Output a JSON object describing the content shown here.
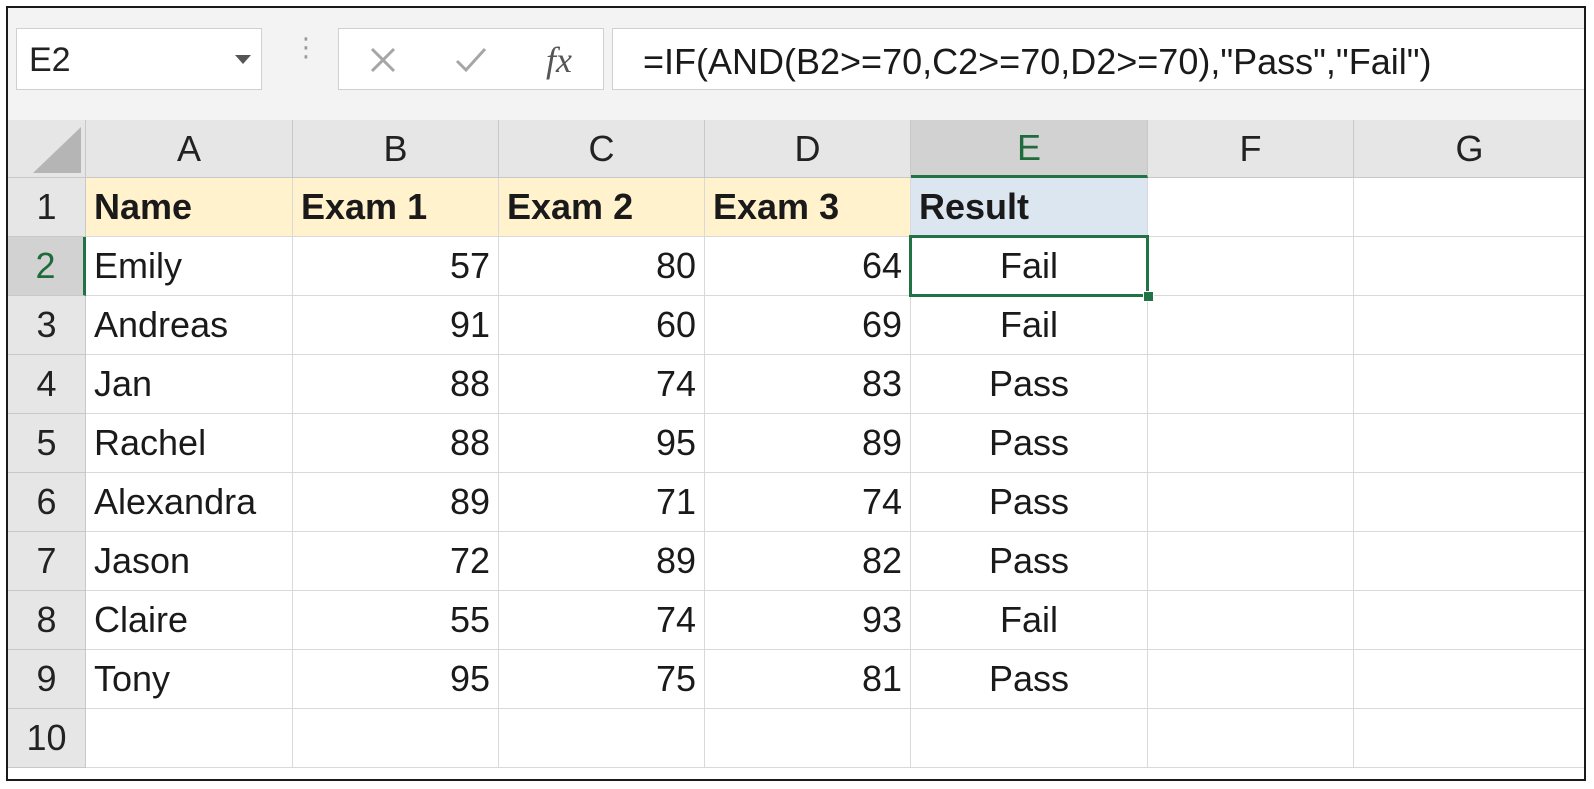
{
  "formula_bar": {
    "name_box": "E2",
    "formula": "=IF(AND(B2>=70,C2>=70,D2>=70),\"Pass\",\"Fail\")",
    "cancel_icon": "close-icon",
    "enter_icon": "check-icon",
    "function_label": "fx"
  },
  "columns": [
    "A",
    "B",
    "C",
    "D",
    "E",
    "F",
    "G"
  ],
  "selected_cell": {
    "column": "E",
    "row": "2"
  },
  "header_row": {
    "row": "1",
    "cells": [
      "Name",
      "Exam 1",
      "Exam 2",
      "Exam 3",
      "Result"
    ]
  },
  "data_rows": [
    {
      "row": "2",
      "name": "Emily",
      "exam1": "57",
      "exam2": "80",
      "exam3": "64",
      "result": "Fail"
    },
    {
      "row": "3",
      "name": "Andreas",
      "exam1": "91",
      "exam2": "60",
      "exam3": "69",
      "result": "Fail"
    },
    {
      "row": "4",
      "name": "Jan",
      "exam1": "88",
      "exam2": "74",
      "exam3": "83",
      "result": "Pass"
    },
    {
      "row": "5",
      "name": "Rachel",
      "exam1": "88",
      "exam2": "95",
      "exam3": "89",
      "result": "Pass"
    },
    {
      "row": "6",
      "name": "Alexandra",
      "exam1": "89",
      "exam2": "71",
      "exam3": "74",
      "result": "Pass"
    },
    {
      "row": "7",
      "name": "Jason",
      "exam1": "72",
      "exam2": "89",
      "exam3": "82",
      "result": "Pass"
    },
    {
      "row": "8",
      "name": "Claire",
      "exam1": "55",
      "exam2": "74",
      "exam3": "93",
      "result": "Fail"
    },
    {
      "row": "9",
      "name": "Tony",
      "exam1": "95",
      "exam2": "75",
      "exam3": "81",
      "result": "Pass"
    }
  ],
  "empty_rows": [
    "10"
  ],
  "colors": {
    "header_fill": "#fff2cc",
    "result_header_fill": "#dce6f1",
    "selection": "#217346"
  }
}
